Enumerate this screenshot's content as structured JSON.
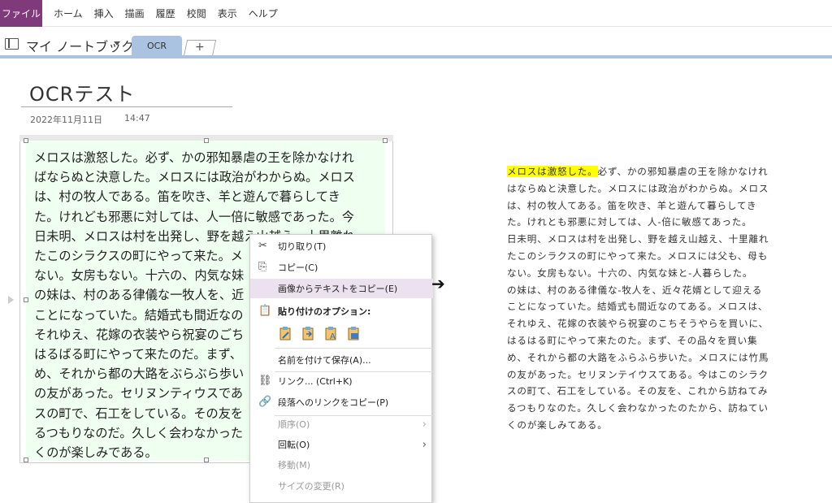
{
  "menubar": {
    "file": "ファイル",
    "items": [
      "ホーム",
      "挿入",
      "描画",
      "履歴",
      "校閲",
      "表示",
      "ヘルプ"
    ]
  },
  "notebook": {
    "name": "マイ ノートブック",
    "tab": "OCR",
    "add_tab": "+"
  },
  "page": {
    "title": "OCRテスト",
    "date": "2022年11月11日",
    "time": "14:47"
  },
  "image_text": [
    "メロスは激怒した。必ず、かの邪知暴虐の王を除かなけれ",
    "ばならぬと決意した。メロスには政治がわからぬ。メロス",
    "は、村の牧人である。笛を吹き、羊と遊んで暮らしてき",
    "た。けれども邪悪に対しては、人一倍に敏感であった。今",
    "日未明、メロスは村を出発し、野を越え山越え、十里離れ",
    "たこのシラクスの町にやって来た。メ",
    "ない。女房もない。十六の、内気な妹",
    "の妹は、村のある律儀な一牧人を、近",
    "ことになっていた。結婚式も間近なの",
    "それゆえ、花嫁の衣装やら祝宴のごち",
    "はるばる町にやって来たのだ。まず、",
    "め、それから都の大路をぶらぶら歩い",
    "の友があった。セリヌンティウスであ",
    "スの町で、石工をしている。その友を",
    "るつもりなのだ。久しく会わなかった",
    "くのが楽しみである。"
  ],
  "context_menu": {
    "cut": "切り取り(T)",
    "copy": "コピー(C)",
    "copy_text_from_image": "画像からテキストをコピー(E)",
    "paste_options": "貼り付けのオプション:",
    "save_as": "名前を付けて保存(A)...",
    "link": "リンク...  (Ctrl+K)",
    "copy_link_paragraph": "段落へのリンクをコピー(P)",
    "order": "順序(O)",
    "rotate": "回転(O)",
    "move": "移動(M)",
    "resize": "サイズの変更(R)"
  },
  "ocr_result": {
    "highlight": "メロスは激怒した。",
    "first_rest": "必ず、かの邪知暴虐の王を除かなけれ",
    "lines": [
      "はならぬと決意した。メロスには政治がわからぬ。メロス",
      "は、村の牧人てある。笛を吹き、羊と遊んて暮らしてき",
      "た。けれとも邪悪に対しては、人-倍に敏感てあった。",
      "日未明、メロスは村を出発し、野を越え山越え、十里離れ",
      "たこのシラクスの町にやって来た。メロスには父も、母も",
      "ない。女房もない。十六の、内気な妹と-人暮らした。",
      "の妹は、村のある律儀な-牧人を、近々花婿として迎える",
      "ことになっていた。結婚式も間近なのてある。メロスは、",
      "それゆえ、花嫁の衣装やら祝宴のこちそうやらを買いに、",
      "はるはる町にやって来たのた。まず、その品々を買い集",
      "め、それから都の大路をふらふら歩いた。メロスには竹馬",
      "の友があった。セリヌンテイウスてある。今はこのシラク",
      "スの町て、石工をしている。その友を、これから訪ねてみ",
      "るつもりなのた。久しく会わなかったのたから、訪ねてい",
      "くのが楽しみてある。"
    ]
  }
}
